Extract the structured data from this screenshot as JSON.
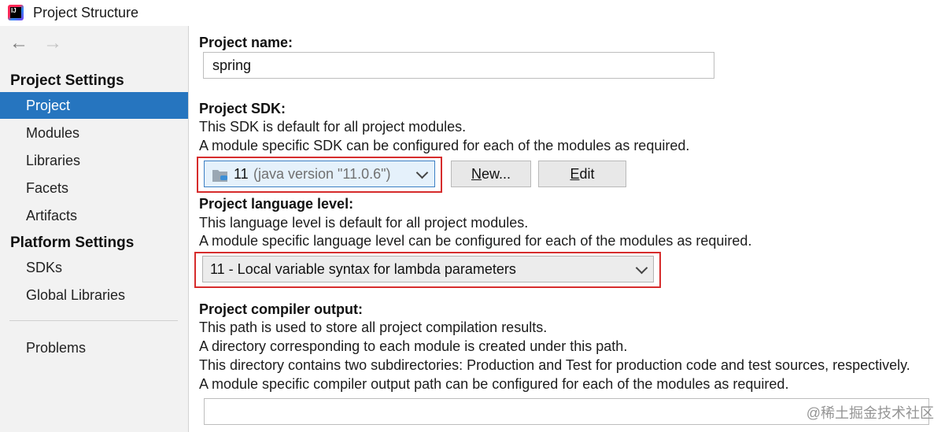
{
  "window": {
    "title": "Project Structure"
  },
  "nav": {
    "back": "←",
    "forward": "→"
  },
  "sidebar": {
    "project_settings_header": "Project Settings",
    "project_items": [
      "Project",
      "Modules",
      "Libraries",
      "Facets",
      "Artifacts"
    ],
    "platform_settings_header": "Platform Settings",
    "platform_items": [
      "SDKs",
      "Global Libraries"
    ],
    "problems": "Problems",
    "selected": "Project"
  },
  "main": {
    "project_name_label": "Project name:",
    "project_name_value": "spring",
    "sdk_label": "Project SDK:",
    "sdk_desc1": "This SDK is default for all project modules.",
    "sdk_desc2": "A module specific SDK can be configured for each of the modules as required.",
    "sdk_value": "11",
    "sdk_detail": "(java version \"11.0.6\")",
    "new_button": {
      "mnemonic": "N",
      "rest": "ew..."
    },
    "edit_button": {
      "mnemonic": "E",
      "rest": "dit"
    },
    "lang_label": "Project language level:",
    "lang_desc1": "This language level is default for all project modules.",
    "lang_desc2": "A module specific language level can be configured for each of the modules as required.",
    "lang_value": "11 - Local variable syntax for lambda parameters",
    "compiler_label": "Project compiler output:",
    "compiler_desc1": "This path is used to store all project compilation results.",
    "compiler_desc2": "A directory corresponding to each module is created under this path.",
    "compiler_desc3": "This directory contains two subdirectories: Production and Test for production code and test sources, respectively.",
    "compiler_desc4": "A module specific compiler output path can be configured for each of the modules as required.",
    "compiler_output_value": ""
  },
  "watermark": "@稀土掘金技术社区",
  "colors": {
    "selection": "#2675bf",
    "highlight_border": "#d62c2c",
    "sidebar_bg": "#f2f2f2"
  }
}
